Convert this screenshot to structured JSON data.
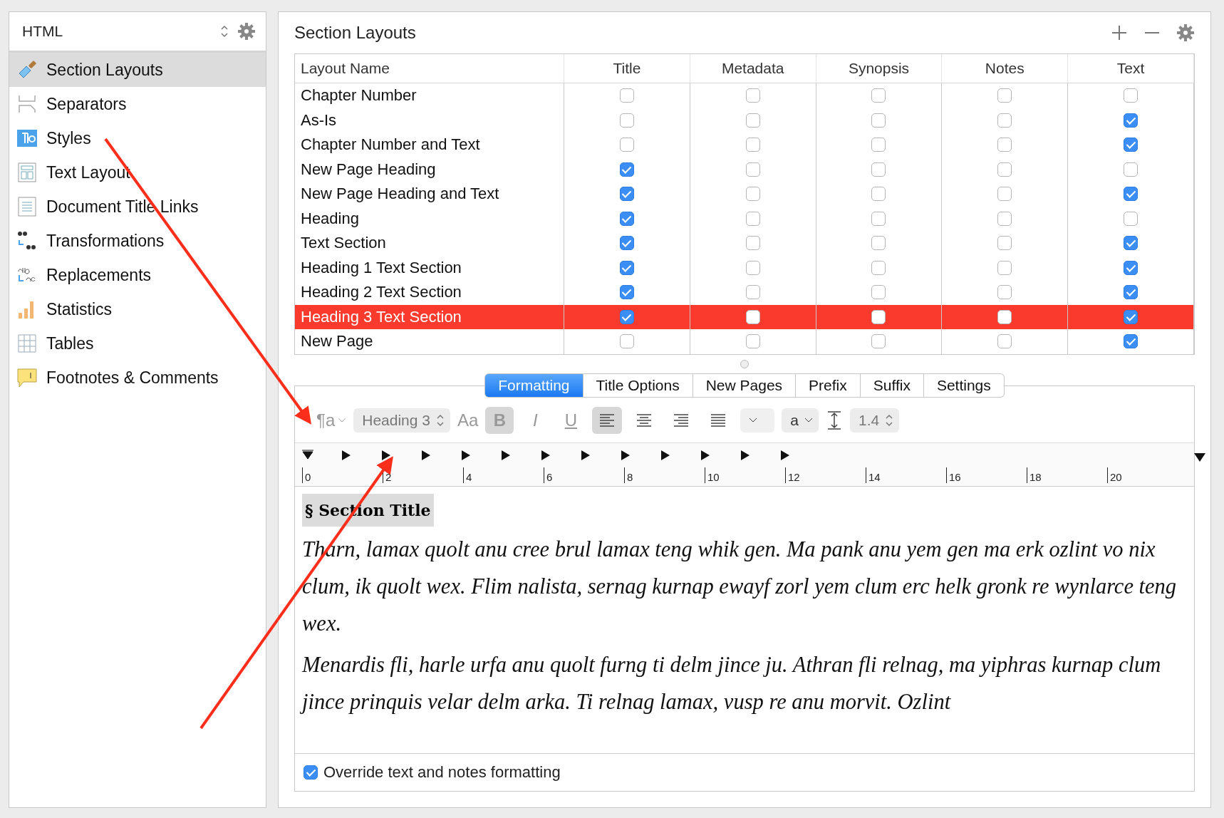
{
  "sidebar": {
    "format": "HTML",
    "items": [
      {
        "label": "Section Layouts",
        "selected": true
      },
      {
        "label": "Separators",
        "selected": false
      },
      {
        "label": "Styles",
        "selected": false
      },
      {
        "label": "Text Layout",
        "selected": false
      },
      {
        "label": "Document Title Links",
        "selected": false
      },
      {
        "label": "Transformations",
        "selected": false
      },
      {
        "label": "Replacements",
        "selected": false
      },
      {
        "label": "Statistics",
        "selected": false
      },
      {
        "label": "Tables",
        "selected": false
      },
      {
        "label": "Footnotes & Comments",
        "selected": false
      }
    ]
  },
  "main": {
    "title": "Section Layouts",
    "table": {
      "columns": [
        "Layout Name",
        "Title",
        "Metadata",
        "Synopsis",
        "Notes",
        "Text"
      ],
      "rows": [
        {
          "name": "Chapter Number",
          "checks": [
            false,
            false,
            false,
            false,
            false
          ],
          "selected": false
        },
        {
          "name": "As-Is",
          "checks": [
            false,
            false,
            false,
            false,
            true
          ],
          "selected": false
        },
        {
          "name": "Chapter Number and Text",
          "checks": [
            false,
            false,
            false,
            false,
            true
          ],
          "selected": false
        },
        {
          "name": "New Page Heading",
          "checks": [
            true,
            false,
            false,
            false,
            false
          ],
          "selected": false
        },
        {
          "name": "New Page Heading and Text",
          "checks": [
            true,
            false,
            false,
            false,
            true
          ],
          "selected": false
        },
        {
          "name": "Heading",
          "checks": [
            true,
            false,
            false,
            false,
            false
          ],
          "selected": false
        },
        {
          "name": "Text Section",
          "checks": [
            true,
            false,
            false,
            false,
            true
          ],
          "selected": false
        },
        {
          "name": "Heading 1 Text Section",
          "checks": [
            true,
            false,
            false,
            false,
            true
          ],
          "selected": false
        },
        {
          "name": "Heading 2 Text Section",
          "checks": [
            true,
            false,
            false,
            false,
            true
          ],
          "selected": false
        },
        {
          "name": "Heading 3 Text Section",
          "checks": [
            true,
            false,
            false,
            false,
            true
          ],
          "selected": true
        },
        {
          "name": "New Page",
          "checks": [
            false,
            false,
            false,
            false,
            true
          ],
          "selected": false
        }
      ]
    },
    "tabs": [
      {
        "label": "Formatting",
        "selected": true
      },
      {
        "label": "Title Options",
        "selected": false
      },
      {
        "label": "New Pages",
        "selected": false
      },
      {
        "label": "Prefix",
        "selected": false
      },
      {
        "label": "Suffix",
        "selected": false
      },
      {
        "label": "Settings",
        "selected": false
      }
    ],
    "toolbar": {
      "style_icon": "¶a",
      "style": "Heading 3",
      "font_button": "Aa",
      "bold": {
        "label": "B",
        "selected": true
      },
      "italic": {
        "label": "I",
        "selected": false
      },
      "underline": {
        "label": "U",
        "selected": false
      },
      "alignments": [
        {
          "kind": "left",
          "selected": true
        },
        {
          "kind": "center",
          "selected": false
        },
        {
          "kind": "right",
          "selected": false
        },
        {
          "kind": "justify",
          "selected": false
        }
      ],
      "case_menu": "a",
      "line_spacing": "1.4"
    },
    "ruler": [
      "0",
      "2",
      "4",
      "6",
      "8",
      "10",
      "12",
      "14",
      "16",
      "18",
      "20"
    ],
    "editor": {
      "heading": "§ Section Title",
      "paragraphs": [
        "Tharn, lamax quolt anu cree brul lamax teng whik gen. Ma pank anu yem gen ma erk ozlint vo nix clum, ik quolt wex. Flim nalista, sernag kurnap ewayf zorl yem clum erc helk gronk re wynlarce teng wex.",
        "Menardis fli, harle urfa anu quolt furng ti delm jince ju. Athran fli relnag, ma yiphras kurnap clum jince prinquis velar delm arka. Ti relnag lamax, vusp re anu morvit. Ozlint"
      ]
    },
    "override": {
      "label": "Override text and notes formatting",
      "checked": true
    }
  }
}
